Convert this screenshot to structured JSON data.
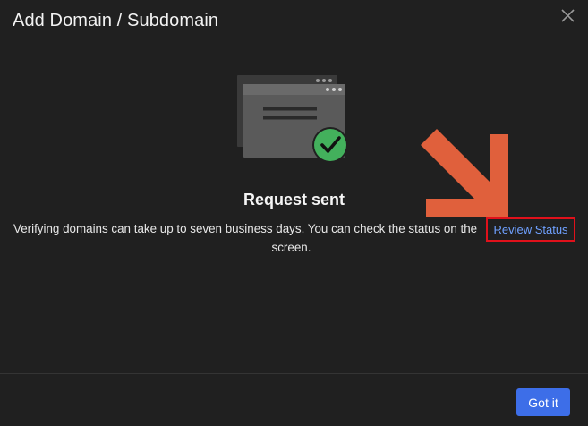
{
  "dialog": {
    "title": "Add Domain / Subdomain",
    "close_icon": "close-icon"
  },
  "illustration": {
    "icon": "browser-window-check-icon",
    "check_color": "#43b05c"
  },
  "content": {
    "heading": "Request sent",
    "message_part1": "Verifying domains can take up to seven business days. You can check the status on the",
    "link_label": "Review Status",
    "message_part2": "screen."
  },
  "annotation": {
    "arrow_icon": "pointer-arrow-icon",
    "arrow_color": "#e0603c",
    "highlight_color": "#e0111b"
  },
  "footer": {
    "primary_button": "Got it",
    "primary_color": "#3d6ee8"
  }
}
